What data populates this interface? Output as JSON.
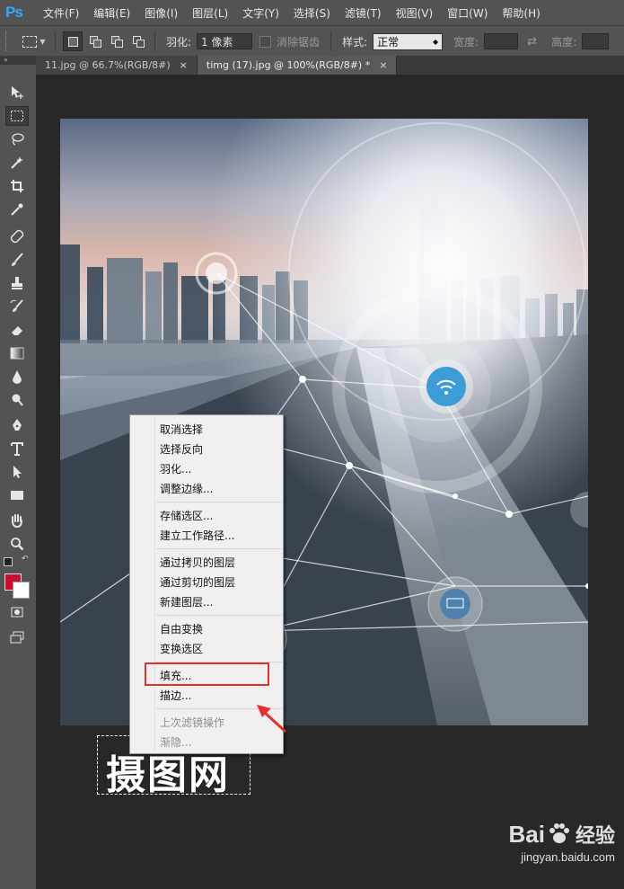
{
  "app": {
    "logo": "Ps"
  },
  "menubar": [
    "文件(F)",
    "编辑(E)",
    "图像(I)",
    "图层(L)",
    "文字(Y)",
    "选择(S)",
    "滤镜(T)",
    "视图(V)",
    "窗口(W)",
    "帮助(H)"
  ],
  "options": {
    "feather_label": "羽化:",
    "feather_value": "1 像素",
    "antialias_label": "消除锯齿",
    "style_label": "样式:",
    "style_value": "正常",
    "width_label": "宽度:",
    "height_label": "高度:"
  },
  "tabs": [
    {
      "label": "11.jpg @ 66.7%(RGB/8#)",
      "close": "×"
    },
    {
      "label": "timg (17).jpg @ 100%(RGB/8#) *",
      "close": "×"
    }
  ],
  "colors": {
    "foreground": "#c8102e",
    "background": "#ffffff",
    "highlight": "#e03131"
  },
  "canvas": {
    "selection_text": "摄图网"
  },
  "context_menu": {
    "groups": [
      [
        "取消选择",
        "选择反向",
        "羽化...",
        "调整边缘..."
      ],
      [
        "存储选区...",
        "建立工作路径..."
      ],
      [
        "通过拷贝的图层",
        "通过剪切的图层",
        "新建图层..."
      ],
      [
        "自由变换",
        "变换选区"
      ],
      [
        "填充...",
        "描边..."
      ],
      [
        "上次滤镜操作",
        "渐隐..."
      ]
    ],
    "highlighted_item": "填充..."
  },
  "watermark": {
    "brand": "Bai",
    "brand_suffix": "经验",
    "url": "jingyan.baidu.com"
  }
}
